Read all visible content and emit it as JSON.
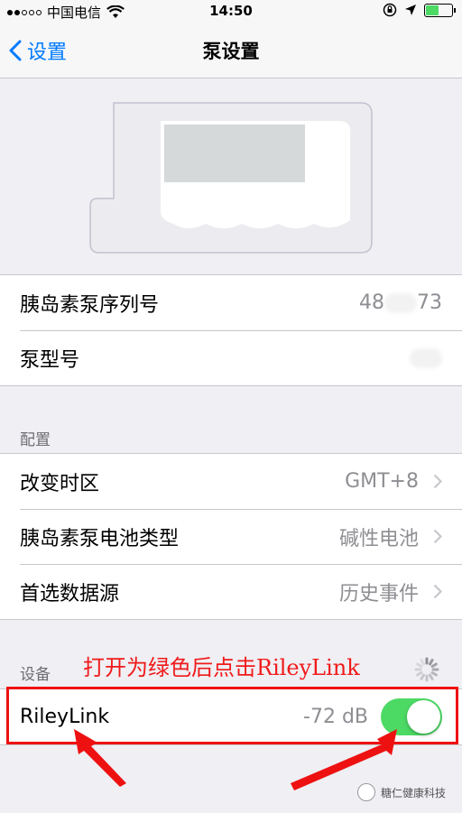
{
  "status_bar": {
    "carrier": "中国电信",
    "time": "14:50"
  },
  "nav": {
    "back_label": "设置",
    "title": "泵设置"
  },
  "info_rows": [
    {
      "label": "胰岛素泵序列号",
      "value_prefix": "48",
      "value_suffix": "73"
    },
    {
      "label": "泵型号",
      "value": ""
    }
  ],
  "config": {
    "header": "配置",
    "rows": [
      {
        "label": "改变时区",
        "value": "GMT+8"
      },
      {
        "label": "胰岛素泵电池类型",
        "value": "碱性电池"
      },
      {
        "label": "首选数据源",
        "value": "历史事件"
      }
    ]
  },
  "devices": {
    "header": "设备",
    "riley": {
      "label": "RileyLink",
      "signal": "-72 dB",
      "enabled": true
    }
  },
  "annotation": {
    "text": "打开为绿色后点击RileyLink"
  },
  "watermark": {
    "text": "糖仁健康科技"
  },
  "colors": {
    "accent": "#007aff",
    "toggle_on": "#4cd964",
    "annotation": "#f01a1a"
  }
}
